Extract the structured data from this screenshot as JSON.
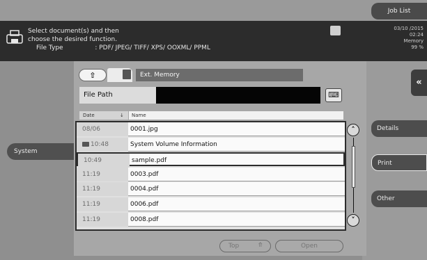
{
  "header": {
    "job_list": "Job List",
    "message_line1": "Select document(s) and then",
    "message_line2": "choose the desired function.",
    "file_type_label": "File Type",
    "file_type_value": ": PDF/ JPEG/ TIFF/ XPS/ OOXML/ PPML",
    "date": "03/10 /2015",
    "time": "02:24",
    "memory_label": "Memory",
    "memory_value": "99 %"
  },
  "navigation": {
    "location": "Ext. Memory",
    "path_label": "File Path",
    "path_value": ""
  },
  "columns": {
    "date": "Date",
    "name": "Name"
  },
  "files": [
    {
      "date": "08/06",
      "name": "0001.jpg",
      "folder": false,
      "selected": false
    },
    {
      "date": "10:48",
      "name": "System Volume Information",
      "folder": true,
      "selected": false
    },
    {
      "date": "10:49",
      "name": "sample.pdf",
      "folder": false,
      "selected": true
    },
    {
      "date": "11:19",
      "name": "0003.pdf",
      "folder": false,
      "selected": false
    },
    {
      "date": "11:19",
      "name": "0004.pdf",
      "folder": false,
      "selected": false
    },
    {
      "date": "11:19",
      "name": "0006.pdf",
      "folder": false,
      "selected": false
    },
    {
      "date": "11:19",
      "name": "0008.pdf",
      "folder": false,
      "selected": false
    }
  ],
  "side": {
    "system": "System",
    "details": "Details",
    "print": "Print",
    "other": "Other"
  },
  "bottom": {
    "top": "Top",
    "open": "Open"
  },
  "icons": {
    "collapse": "double-chevron-left-icon",
    "up": "up-arrow-icon",
    "keyboard": "keyboard-icon",
    "printer": "printer-icon"
  },
  "colors": {
    "message_bar": "#2c2c2c",
    "selected_border": "#2c2c2c"
  }
}
